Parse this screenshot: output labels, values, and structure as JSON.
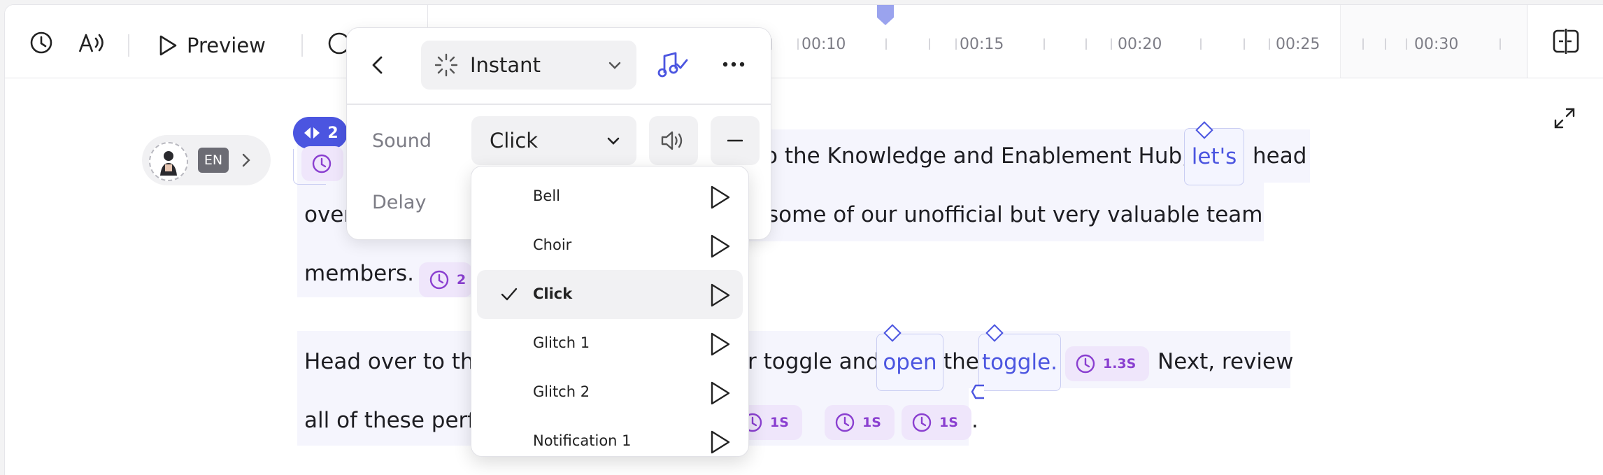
{
  "toolbar": {
    "preview_label": "Preview",
    "icons": [
      "clock-icon",
      "voice-icon",
      "play-icon",
      "avatar-icon",
      "split-panel-icon"
    ]
  },
  "timeline": {
    "ticks": [
      "00:10",
      "00:15",
      "00:20",
      "00:25",
      "00:30"
    ]
  },
  "language": {
    "code": "EN"
  },
  "scene_badge": {
    "count": "2"
  },
  "script": {
    "line1_prefix": "o the Knowledge and Enablement Hub,",
    "line1_word": "let's",
    "line1_suffix": "head",
    "line2_start": "over",
    "line2_end": "some of our unofficial but very valuable team",
    "line3": "members.",
    "line3_pause": "2",
    "line4_start": "Head over to th",
    "line4_mid": "r toggle and",
    "line4_word1": "open",
    "line4_the": "the",
    "line4_word2": "toggle.",
    "line4_pause": "1.3S",
    "line4_end": "Next, review",
    "line5_start": "all of these perf",
    "pauses": [
      "1S",
      "1S",
      "1S"
    ],
    "line5_end": "."
  },
  "panel": {
    "mode_label": "Instant",
    "sound_row_label": "Sound",
    "sound_value": "Click",
    "delay_row_label": "Delay"
  },
  "sound_options": [
    {
      "label": "Bell",
      "selected": false
    },
    {
      "label": "Choir",
      "selected": false
    },
    {
      "label": "Click",
      "selected": true
    },
    {
      "label": "Glitch 1",
      "selected": false
    },
    {
      "label": "Glitch 2",
      "selected": false
    },
    {
      "label": "Notification 1",
      "selected": false
    }
  ],
  "colors": {
    "accent": "#4b55e0",
    "pause_bg": "#efe6fb",
    "pause_text": "#8a3fd0",
    "highlight": "#f5f5fd"
  }
}
